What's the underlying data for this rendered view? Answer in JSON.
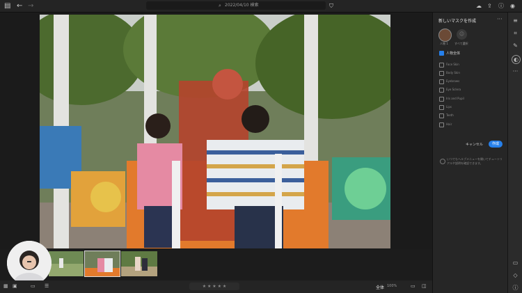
{
  "topbar": {
    "search_text": "2022/04/10 検索"
  },
  "panel": {
    "title": "新しいマスクを作成",
    "person1_label": "人物 1",
    "all_label": "すべて選択",
    "person_all": "人物全体",
    "options": [
      "Face Skin",
      "Body Skin",
      "Eyebrows",
      "Eye Sclera",
      "Iris and Pupil",
      "Lips",
      "Teeth",
      "Hair"
    ],
    "cancel": "キャンセル",
    "create": "作成",
    "help": "いつでもヘルプメニューを開いてチュートリアルや説明を確認できます。"
  },
  "bottom": {
    "stars": "★ ★ ★ ★ ★",
    "zoom_label": "全体",
    "zoom_value": "100%"
  },
  "icons": [
    "panel-toggle-icon",
    "back-icon",
    "forward-icon",
    "search-icon",
    "filter-icon",
    "cloud-icon",
    "share-icon",
    "help-icon",
    "account-icon",
    "edit-icon",
    "crop-icon",
    "heal-icon",
    "mask-icon",
    "more-icon",
    "comment-icon",
    "tag-icon",
    "info-icon"
  ]
}
